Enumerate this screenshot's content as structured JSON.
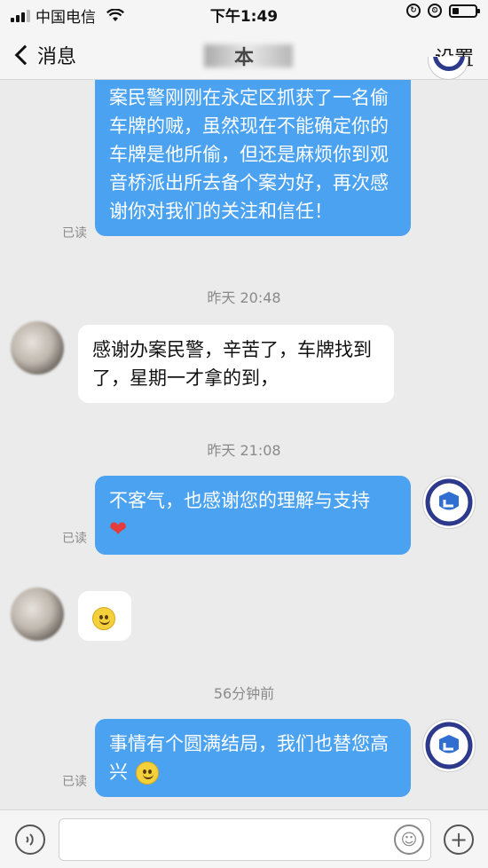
{
  "status_bar": {
    "carrier": "中国电信",
    "time": "下午1:49"
  },
  "nav": {
    "back_label": "消息",
    "title": "本",
    "settings_label": "设置"
  },
  "messages": [
    {
      "type": "out",
      "text": "案民警刚刚在永定区抓获了一名偷车牌的贼，虽然现在不能确定你的车牌是他所偷，但还是麻烦你到观音桥派出所去备个案为好，再次感谢你对我们的关注和信任！",
      "read": "已读"
    },
    {
      "type": "timestamp",
      "text": "昨天 20:48"
    },
    {
      "type": "in",
      "text": "感谢办案民警，辛苦了，车牌找到了，星期一才拿的到，"
    },
    {
      "type": "timestamp",
      "text": "昨天 21:08"
    },
    {
      "type": "out",
      "text": "不客气，也感谢您的理解与支持",
      "emoji": "❤",
      "read": "已读"
    },
    {
      "type": "in",
      "emoji": "smile"
    },
    {
      "type": "timestamp",
      "text": "56分钟前"
    },
    {
      "type": "out",
      "text": "事情有个圆满结局，我们也替您高兴",
      "emoji": "smile-blush",
      "read": "已读"
    }
  ],
  "input_bar": {
    "placeholder": "",
    "icons": [
      "voice-icon",
      "emoji-icon",
      "plus-icon"
    ]
  },
  "colors": {
    "out_bubble": "#4aa2f0",
    "in_bubble": "#ffffff",
    "background": "#ebebeb",
    "timestamp": "#8a8a8a"
  }
}
